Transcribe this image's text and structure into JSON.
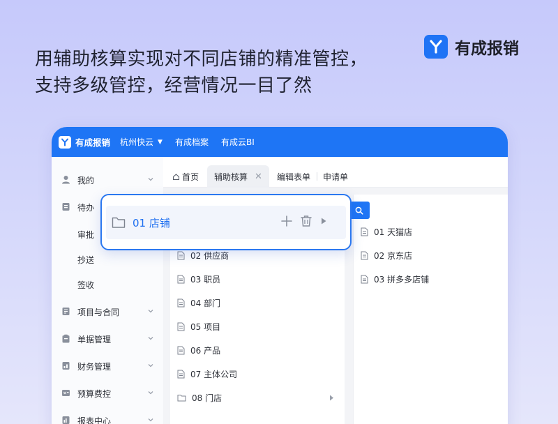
{
  "headline": {
    "line1": "用辅助核算实现对不同店铺的精准管控，",
    "line2": "支持多级管控，经营情况一目了然"
  },
  "brand": {
    "name": "有成报销",
    "color": "#1f73f5"
  },
  "topbar": {
    "brand": "有成报销",
    "company": "杭州快云",
    "links": [
      "有成档案",
      "有成云BI"
    ],
    "color": "#1e75f5"
  },
  "sidebar": {
    "items": [
      {
        "label": "我的",
        "icon": "user-icon"
      },
      {
        "label": "待办",
        "icon": "todo-icon"
      },
      {
        "label": "审批"
      },
      {
        "label": "抄送"
      },
      {
        "label": "签收"
      },
      {
        "label": "项目与合同",
        "icon": "contract-icon"
      },
      {
        "label": "单据管理",
        "icon": "clipboard-icon"
      },
      {
        "label": "财务管理",
        "icon": "finance-icon"
      },
      {
        "label": "预算费控",
        "icon": "budget-icon"
      },
      {
        "label": "报表中心",
        "icon": "report-icon"
      }
    ]
  },
  "tabs": {
    "home": "首页",
    "active": "辅助核算",
    "others": [
      "编辑表单",
      "申请单"
    ],
    "close": "✕"
  },
  "left_list": [
    {
      "label": "02 供应商",
      "type": "file"
    },
    {
      "label": "03 职员",
      "type": "file"
    },
    {
      "label": "04 部门",
      "type": "file"
    },
    {
      "label": "05 项目",
      "type": "file"
    },
    {
      "label": "06 产品",
      "type": "file"
    },
    {
      "label": "07 主体公司",
      "type": "file"
    },
    {
      "label": "08 门店",
      "type": "folder"
    }
  ],
  "right_list": [
    {
      "label": "01 天猫店"
    },
    {
      "label": "02 京东店"
    },
    {
      "label": "03 拼多多店铺"
    }
  ],
  "highlight": {
    "label": "01 店铺",
    "accent": "#2b78f0"
  }
}
